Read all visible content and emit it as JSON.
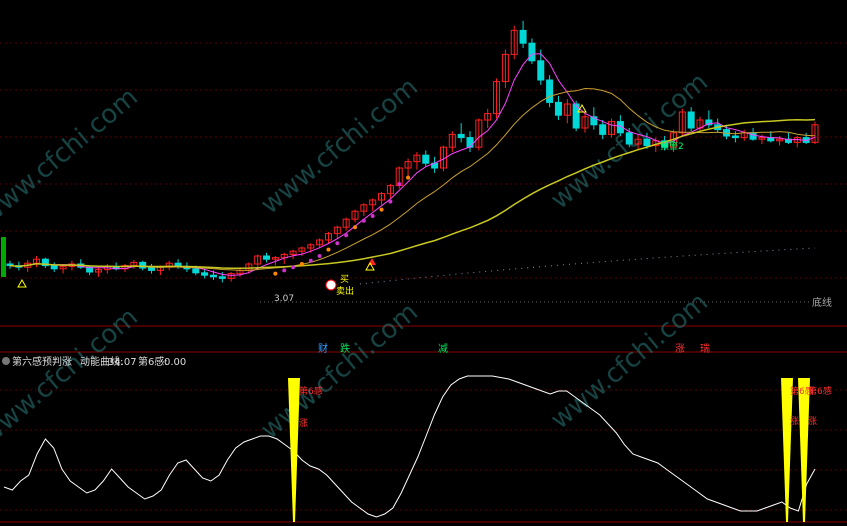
{
  "watermark": "www.cfchi.com",
  "top_chart": {
    "markers": {
      "low_price": "3.07",
      "buy_label": "买",
      "sell_label": "卖出",
      "warning_label": "预警2",
      "triangle_label": "Δ"
    },
    "baseline_label": "底线",
    "bottom_tags": [
      {
        "text": "财",
        "color": "#3aa0ff"
      },
      {
        "text": "跌",
        "color": "#00e060"
      },
      {
        "text": "减",
        "color": "#00e060"
      },
      {
        "text": "涨",
        "color": "#ff3030"
      },
      {
        "text": "瑞",
        "color": "#ff3030"
      }
    ]
  },
  "indicator_panel": {
    "title": "第六感预判涨",
    "series_name": "动能曲线:",
    "series_value": "34.07",
    "signal_name": "第6感:",
    "signal_value": "0.00",
    "signal_labels": [
      "第6感",
      "涨"
    ],
    "signal_labels_right": [
      "第6感",
      "第6感",
      "涨",
      "涨"
    ]
  },
  "colors": {
    "up": "#ff2020",
    "down": "#00d8d8",
    "ma_short": "#ff40ff",
    "ma_mid": "#c8a030",
    "ma_long": "#c8c820",
    "grid": "#5a0000",
    "momentum": "#ffffff",
    "signal_bar": "#ffff00"
  },
  "chart_data": [
    {
      "type": "candlestick",
      "title": "",
      "candles": [
        [
          3.3,
          3.34,
          3.24,
          3.28
        ],
        [
          3.28,
          3.33,
          3.22,
          3.26
        ],
        [
          3.26,
          3.35,
          3.2,
          3.31
        ],
        [
          3.31,
          3.4,
          3.26,
          3.36
        ],
        [
          3.36,
          3.38,
          3.25,
          3.28
        ],
        [
          3.28,
          3.32,
          3.2,
          3.24
        ],
        [
          3.24,
          3.3,
          3.18,
          3.27
        ],
        [
          3.27,
          3.34,
          3.22,
          3.3
        ],
        [
          3.3,
          3.36,
          3.24,
          3.26
        ],
        [
          3.26,
          3.28,
          3.16,
          3.2
        ],
        [
          3.2,
          3.26,
          3.14,
          3.23
        ],
        [
          3.23,
          3.3,
          3.18,
          3.27
        ],
        [
          3.27,
          3.32,
          3.22,
          3.24
        ],
        [
          3.24,
          3.3,
          3.2,
          3.28
        ],
        [
          3.28,
          3.35,
          3.24,
          3.32
        ],
        [
          3.32,
          3.34,
          3.22,
          3.25
        ],
        [
          3.25,
          3.3,
          3.18,
          3.22
        ],
        [
          3.22,
          3.28,
          3.16,
          3.26
        ],
        [
          3.26,
          3.34,
          3.22,
          3.31
        ],
        [
          3.31,
          3.36,
          3.24,
          3.27
        ],
        [
          3.27,
          3.32,
          3.2,
          3.24
        ],
        [
          3.24,
          3.28,
          3.16,
          3.19
        ],
        [
          3.19,
          3.24,
          3.12,
          3.16
        ],
        [
          3.16,
          3.22,
          3.1,
          3.14
        ],
        [
          3.14,
          3.2,
          3.07,
          3.12
        ],
        [
          3.12,
          3.2,
          3.08,
          3.18
        ],
        [
          3.18,
          3.26,
          3.14,
          3.22
        ],
        [
          3.22,
          3.32,
          3.18,
          3.3
        ],
        [
          3.3,
          3.42,
          3.26,
          3.4
        ],
        [
          3.4,
          3.44,
          3.32,
          3.36
        ],
        [
          3.36,
          3.4,
          3.28,
          3.38
        ],
        [
          3.38,
          3.44,
          3.3,
          3.42
        ],
        [
          3.42,
          3.48,
          3.36,
          3.46
        ],
        [
          3.46,
          3.52,
          3.4,
          3.5
        ],
        [
          3.5,
          3.56,
          3.44,
          3.54
        ],
        [
          3.54,
          3.62,
          3.5,
          3.6
        ],
        [
          3.6,
          3.7,
          3.56,
          3.68
        ],
        [
          3.68,
          3.78,
          3.62,
          3.76
        ],
        [
          3.76,
          3.88,
          3.72,
          3.86
        ],
        [
          3.86,
          3.98,
          3.82,
          3.96
        ],
        [
          3.96,
          4.06,
          3.9,
          4.04
        ],
        [
          4.04,
          4.12,
          3.96,
          4.1
        ],
        [
          4.1,
          4.2,
          4.04,
          4.18
        ],
        [
          4.18,
          4.3,
          4.12,
          4.28
        ],
        [
          4.28,
          4.52,
          4.24,
          4.5
        ],
        [
          4.5,
          4.62,
          4.4,
          4.58
        ],
        [
          4.58,
          4.7,
          4.48,
          4.66
        ],
        [
          4.66,
          4.72,
          4.52,
          4.56
        ],
        [
          4.56,
          4.64,
          4.44,
          4.5
        ],
        [
          4.5,
          4.78,
          4.46,
          4.76
        ],
        [
          4.76,
          4.96,
          4.7,
          4.92
        ],
        [
          4.92,
          5.06,
          4.82,
          4.88
        ],
        [
          4.88,
          4.96,
          4.7,
          4.76
        ],
        [
          4.76,
          5.12,
          4.72,
          5.1
        ],
        [
          5.1,
          5.24,
          5.0,
          5.18
        ],
        [
          5.18,
          5.62,
          5.12,
          5.58
        ],
        [
          5.58,
          5.98,
          5.5,
          5.92
        ],
        [
          5.92,
          6.28,
          5.86,
          6.22
        ],
        [
          6.22,
          6.34,
          6.0,
          6.06
        ],
        [
          6.06,
          6.12,
          5.8,
          5.84
        ],
        [
          5.84,
          5.98,
          5.54,
          5.6
        ],
        [
          5.6,
          5.66,
          5.26,
          5.32
        ],
        [
          5.32,
          5.4,
          5.1,
          5.16
        ],
        [
          5.16,
          5.36,
          5.06,
          5.3
        ],
        [
          5.3,
          5.34,
          4.96,
          5.0
        ],
        [
          5.0,
          5.2,
          4.94,
          5.14
        ],
        [
          5.14,
          5.26,
          4.98,
          5.04
        ],
        [
          5.04,
          5.1,
          4.86,
          4.92
        ],
        [
          4.92,
          5.12,
          4.88,
          5.08
        ],
        [
          5.08,
          5.16,
          4.9,
          4.94
        ],
        [
          4.94,
          5.0,
          4.76,
          4.8
        ],
        [
          4.8,
          4.92,
          4.72,
          4.86
        ],
        [
          4.86,
          4.94,
          4.74,
          4.78
        ],
        [
          4.78,
          4.88,
          4.7,
          4.84
        ],
        [
          4.84,
          4.9,
          4.72,
          4.76
        ],
        [
          4.76,
          4.98,
          4.7,
          4.94
        ],
        [
          4.94,
          5.24,
          4.9,
          5.2
        ],
        [
          5.2,
          5.26,
          4.96,
          5.0
        ],
        [
          5.0,
          5.14,
          4.94,
          5.1
        ],
        [
          5.1,
          5.22,
          5.0,
          5.04
        ],
        [
          5.04,
          5.12,
          4.94,
          4.98
        ],
        [
          4.98,
          5.04,
          4.86,
          4.9
        ],
        [
          4.9,
          4.96,
          4.82,
          4.88
        ],
        [
          4.88,
          4.98,
          4.84,
          4.94
        ],
        [
          4.94,
          5.0,
          4.84,
          4.86
        ],
        [
          4.86,
          4.92,
          4.8,
          4.88
        ],
        [
          4.88,
          4.96,
          4.82,
          4.84
        ],
        [
          4.84,
          4.9,
          4.78,
          4.86
        ],
        [
          4.86,
          4.94,
          4.8,
          4.82
        ],
        [
          4.82,
          4.9,
          4.76,
          4.88
        ],
        [
          4.88,
          4.94,
          4.8,
          4.82
        ],
        [
          4.82,
          5.08,
          4.8,
          5.04
        ]
      ],
      "ylim": [
        2.8,
        6.6
      ]
    },
    {
      "type": "line",
      "series": [
        {
          "values": [
            22,
            20,
            26,
            30,
            44,
            54,
            48,
            34,
            26,
            22,
            18,
            20,
            26,
            34,
            28,
            22,
            18,
            14,
            16,
            20,
            30,
            38,
            40,
            34,
            28,
            26,
            30,
            40,
            48,
            52,
            54,
            56,
            56,
            54,
            50,
            46,
            40,
            36,
            34,
            30,
            24,
            18,
            12,
            8,
            4,
            2,
            4,
            8,
            18,
            30,
            42,
            56,
            70,
            82,
            90,
            94,
            96,
            96,
            96,
            96,
            95,
            94,
            92,
            90,
            88,
            86,
            84,
            86,
            86,
            82,
            78,
            74,
            70,
            64,
            58,
            50,
            44,
            42,
            40,
            38,
            34,
            30,
            26,
            22,
            18,
            14,
            12,
            10,
            8,
            6,
            6,
            6,
            8,
            10,
            12,
            8,
            6,
            24,
            34
          ]
        }
      ],
      "ylim": [
        0,
        100
      ]
    }
  ]
}
